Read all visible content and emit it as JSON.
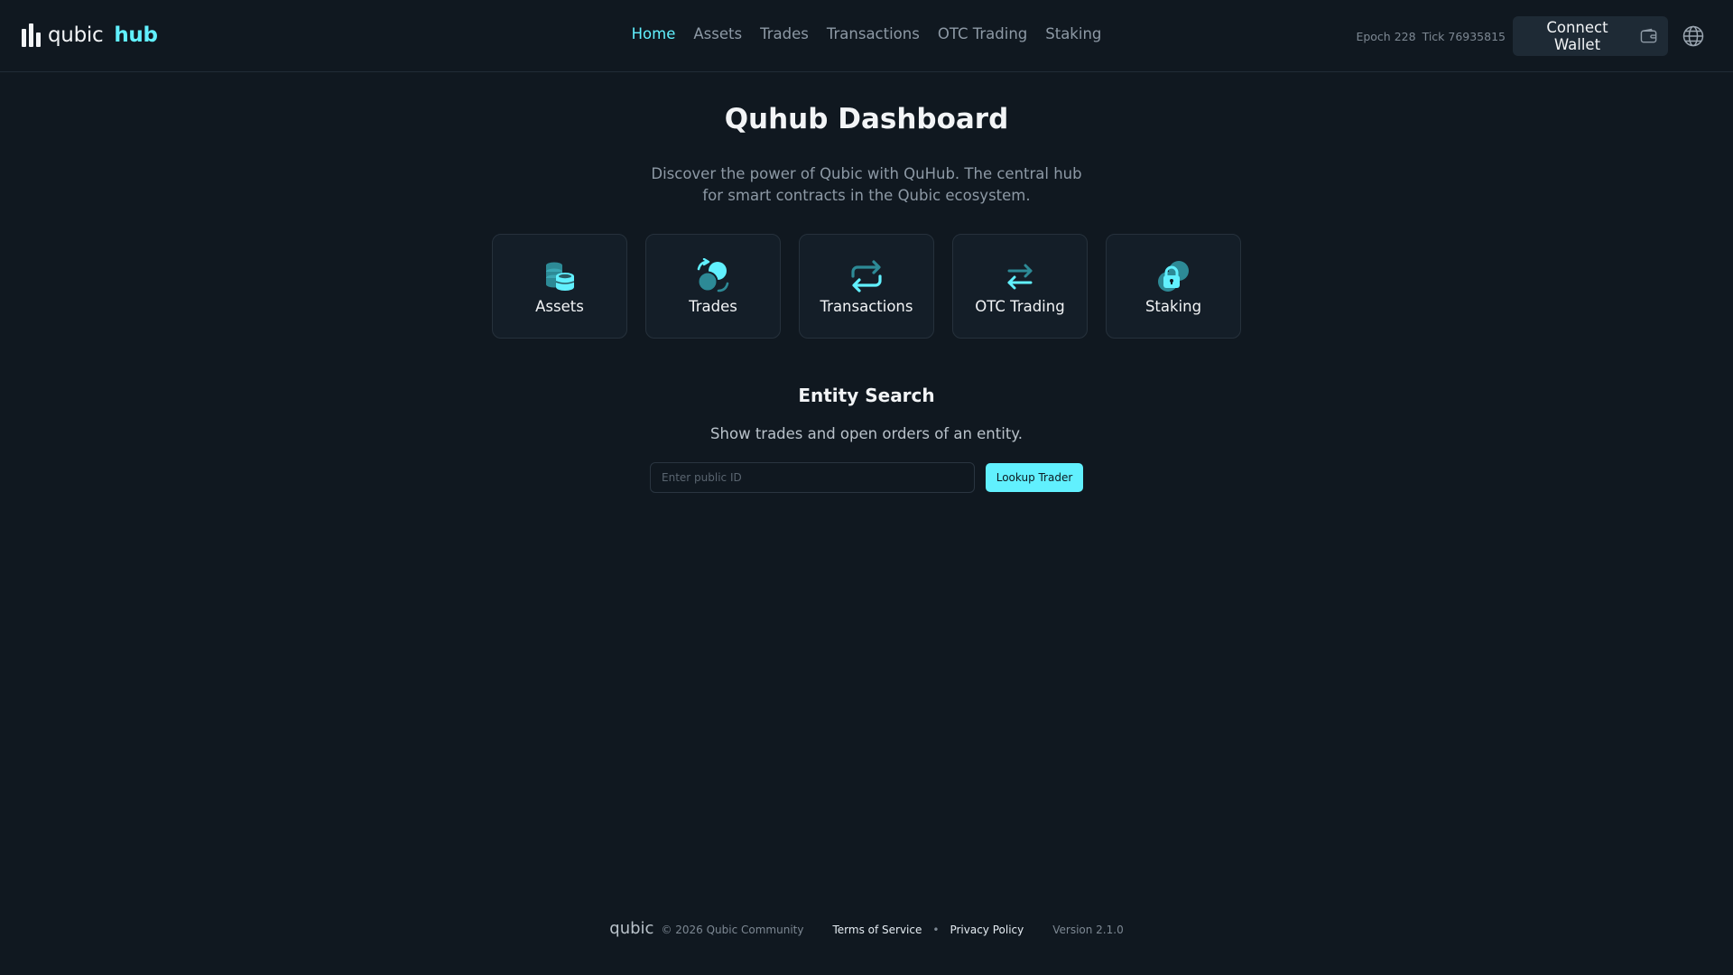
{
  "header": {
    "logo_text": "qubic",
    "logo_accent": "hub",
    "nav": [
      {
        "label": "Home",
        "active": true
      },
      {
        "label": "Assets",
        "active": false
      },
      {
        "label": "Trades",
        "active": false
      },
      {
        "label": "Transactions",
        "active": false
      },
      {
        "label": "OTC Trading",
        "active": false
      },
      {
        "label": "Staking",
        "active": false
      }
    ],
    "epoch": "Epoch 228",
    "tick": "Tick 76935815",
    "connect_label": "Connect Wallet",
    "connect_icon": "wallet-icon",
    "language_icon": "globe-icon"
  },
  "main": {
    "title": "Quhub Dashboard",
    "subtitle": "Discover the power of Qubic with QuHub. The central hub for smart contracts in the Qubic ecosystem.",
    "cards": [
      {
        "label": "Assets",
        "icon": "coins-stack-icon"
      },
      {
        "label": "Trades",
        "icon": "exchange-coins-icon"
      },
      {
        "label": "Transactions",
        "icon": "repeat-arrows-icon"
      },
      {
        "label": "OTC Trading",
        "icon": "swap-arrows-icon"
      },
      {
        "label": "Staking",
        "icon": "lock-coin-icon"
      }
    ],
    "search": {
      "title": "Entity Search",
      "description": "Show trades and open orders of an entity.",
      "placeholder": "Enter public ID",
      "value": "",
      "button_label": "Lookup Trader"
    }
  },
  "footer": {
    "logo": "qubic",
    "copyright": "© 2026 Qubic Community",
    "terms": "Terms of Service",
    "separator": "•",
    "privacy": "Privacy Policy",
    "version": "Version 2.1.0"
  },
  "colors": {
    "background": "#101820",
    "accent": "#61f0fe",
    "card_background": "#141e28",
    "muted_text": "#8d99a5"
  }
}
